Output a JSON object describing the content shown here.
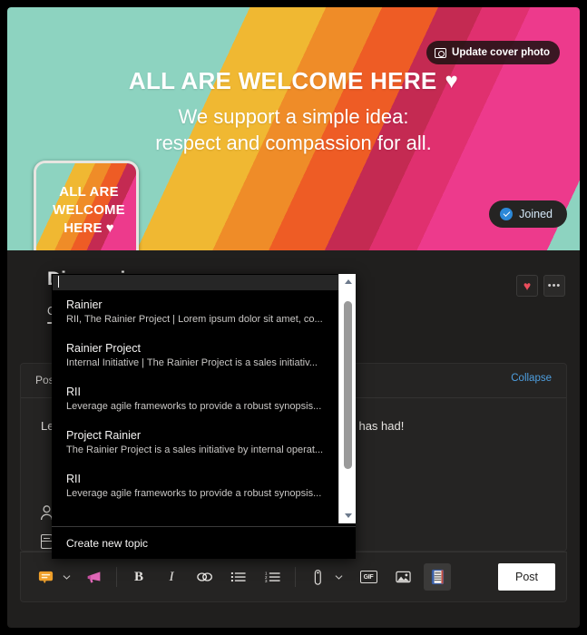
{
  "cover": {
    "title": "ALL ARE WELCOME HERE",
    "title_heart": "♥",
    "subtitle_line1": "We support a simple idea:",
    "subtitle_line2": "respect and compassion for all.",
    "update_button_label": "Update cover photo",
    "update_button_icon": "camera-icon",
    "joined_button_label": "Joined",
    "joined_button_icon": "check-circle-icon",
    "colors": {
      "mint": "#8dd3c0",
      "gray_purple": "#9691a3",
      "yellow": "#f0b832",
      "orange": "#ee5c25",
      "crimson": "#c42a52",
      "pink": "#ed3a8c"
    }
  },
  "avatar": {
    "line1": "ALL ARE",
    "line2": "WELCOME",
    "line3": "HERE",
    "heart": "♥",
    "name": "group-avatar"
  },
  "header": {
    "group_title": "Discussion",
    "tabs": [
      {
        "label": "Conversations",
        "selected": true
      }
    ],
    "actions": [
      {
        "name": "favorite-button",
        "icon": "heart-icon",
        "glyph": "♥"
      },
      {
        "name": "more-options-button",
        "icon": "ellipsis-icon",
        "glyph": "•••"
      }
    ]
  },
  "post": {
    "label": "Post",
    "collapse_label": "Collapse",
    "body_text": "Leverage agile frameworks to provide a robust synopsis that has had!",
    "add_people_icon": "add-people-icon",
    "topic_chip": {
      "label": "Rainier",
      "icon": "topic-book-icon"
    }
  },
  "toolbar": {
    "items": [
      {
        "name": "sticker-button",
        "icon": "sticker-icon",
        "type": "emoji-sticker",
        "has_chevron": true
      },
      {
        "name": "announcement-button",
        "icon": "megaphone-icon",
        "type": "megaphone"
      },
      {
        "name": "bold-button",
        "icon": "bold-icon",
        "glyph": "B"
      },
      {
        "name": "italic-button",
        "icon": "italic-icon",
        "glyph": "I"
      },
      {
        "name": "link-button",
        "icon": "link-icon"
      },
      {
        "name": "bulleted-list-button",
        "icon": "bulleted-list-icon"
      },
      {
        "name": "numbered-list-button",
        "icon": "numbered-list-icon"
      },
      {
        "name": "attach-button",
        "icon": "paperclip-icon",
        "has_chevron": true
      },
      {
        "name": "gif-button",
        "icon": "gif-icon",
        "glyph": "GIF"
      },
      {
        "name": "image-button",
        "icon": "image-icon"
      },
      {
        "name": "topic-button",
        "icon": "topic-card-icon",
        "active": true
      }
    ],
    "post_label": "Post",
    "chevron_glyph": "⌄"
  },
  "dropdown": {
    "search_value": "",
    "search_placeholder": "",
    "items": [
      {
        "title": "Rainier",
        "subtitle": "RII, The Rainier Project | Lorem ipsum dolor sit amet, co..."
      },
      {
        "title": "Rainier Project",
        "subtitle": "Internal Initiative | The Rainier Project is a sales initiativ..."
      },
      {
        "title": "RII",
        "subtitle": "Leverage agile frameworks to provide a robust synopsis..."
      },
      {
        "title": "Project Rainier",
        "subtitle": "The Rainier Project is a sales initiative by internal operat..."
      },
      {
        "title": "RII",
        "subtitle": "Leverage agile frameworks to provide a robust synopsis..."
      }
    ],
    "create_label": "Create new topic",
    "scrollbar": {
      "up_icon": "scroll-up-arrow-icon",
      "down_icon": "scroll-down-arrow-icon"
    }
  }
}
